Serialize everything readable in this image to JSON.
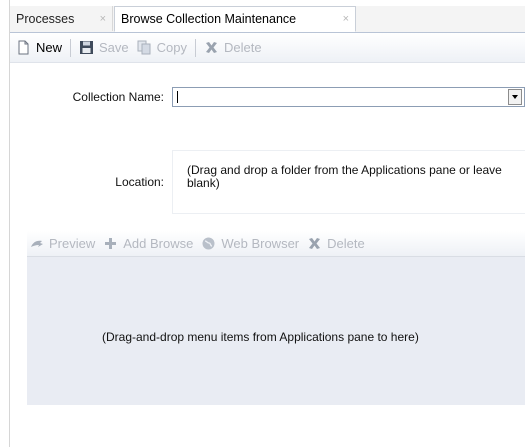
{
  "tabs": [
    {
      "label": "Processes",
      "close": "×"
    },
    {
      "label": "Browse Collection Maintenance",
      "close": "×"
    }
  ],
  "toolbar": {
    "new_label": "New",
    "save_label": "Save",
    "copy_label": "Copy",
    "delete_label": "Delete"
  },
  "form": {
    "collection_name_label": "Collection Name:",
    "collection_name_value": "",
    "location_label": "Location:",
    "location_hint": "(Drag and drop a folder from the Applications pane or leave blank)"
  },
  "menu_toolbar": {
    "preview_label": "Preview",
    "add_browse_label": "Add Browse",
    "web_browser_label": "Web Browser",
    "delete_label": "Delete"
  },
  "dropzone": {
    "hint": "(Drag-and-drop menu items from Applications pane to here)"
  },
  "colors": {
    "disabled_text": "#b4b8c0",
    "dropzone_bg": "#e9ecf3",
    "tab_border": "#b9c4d6"
  }
}
